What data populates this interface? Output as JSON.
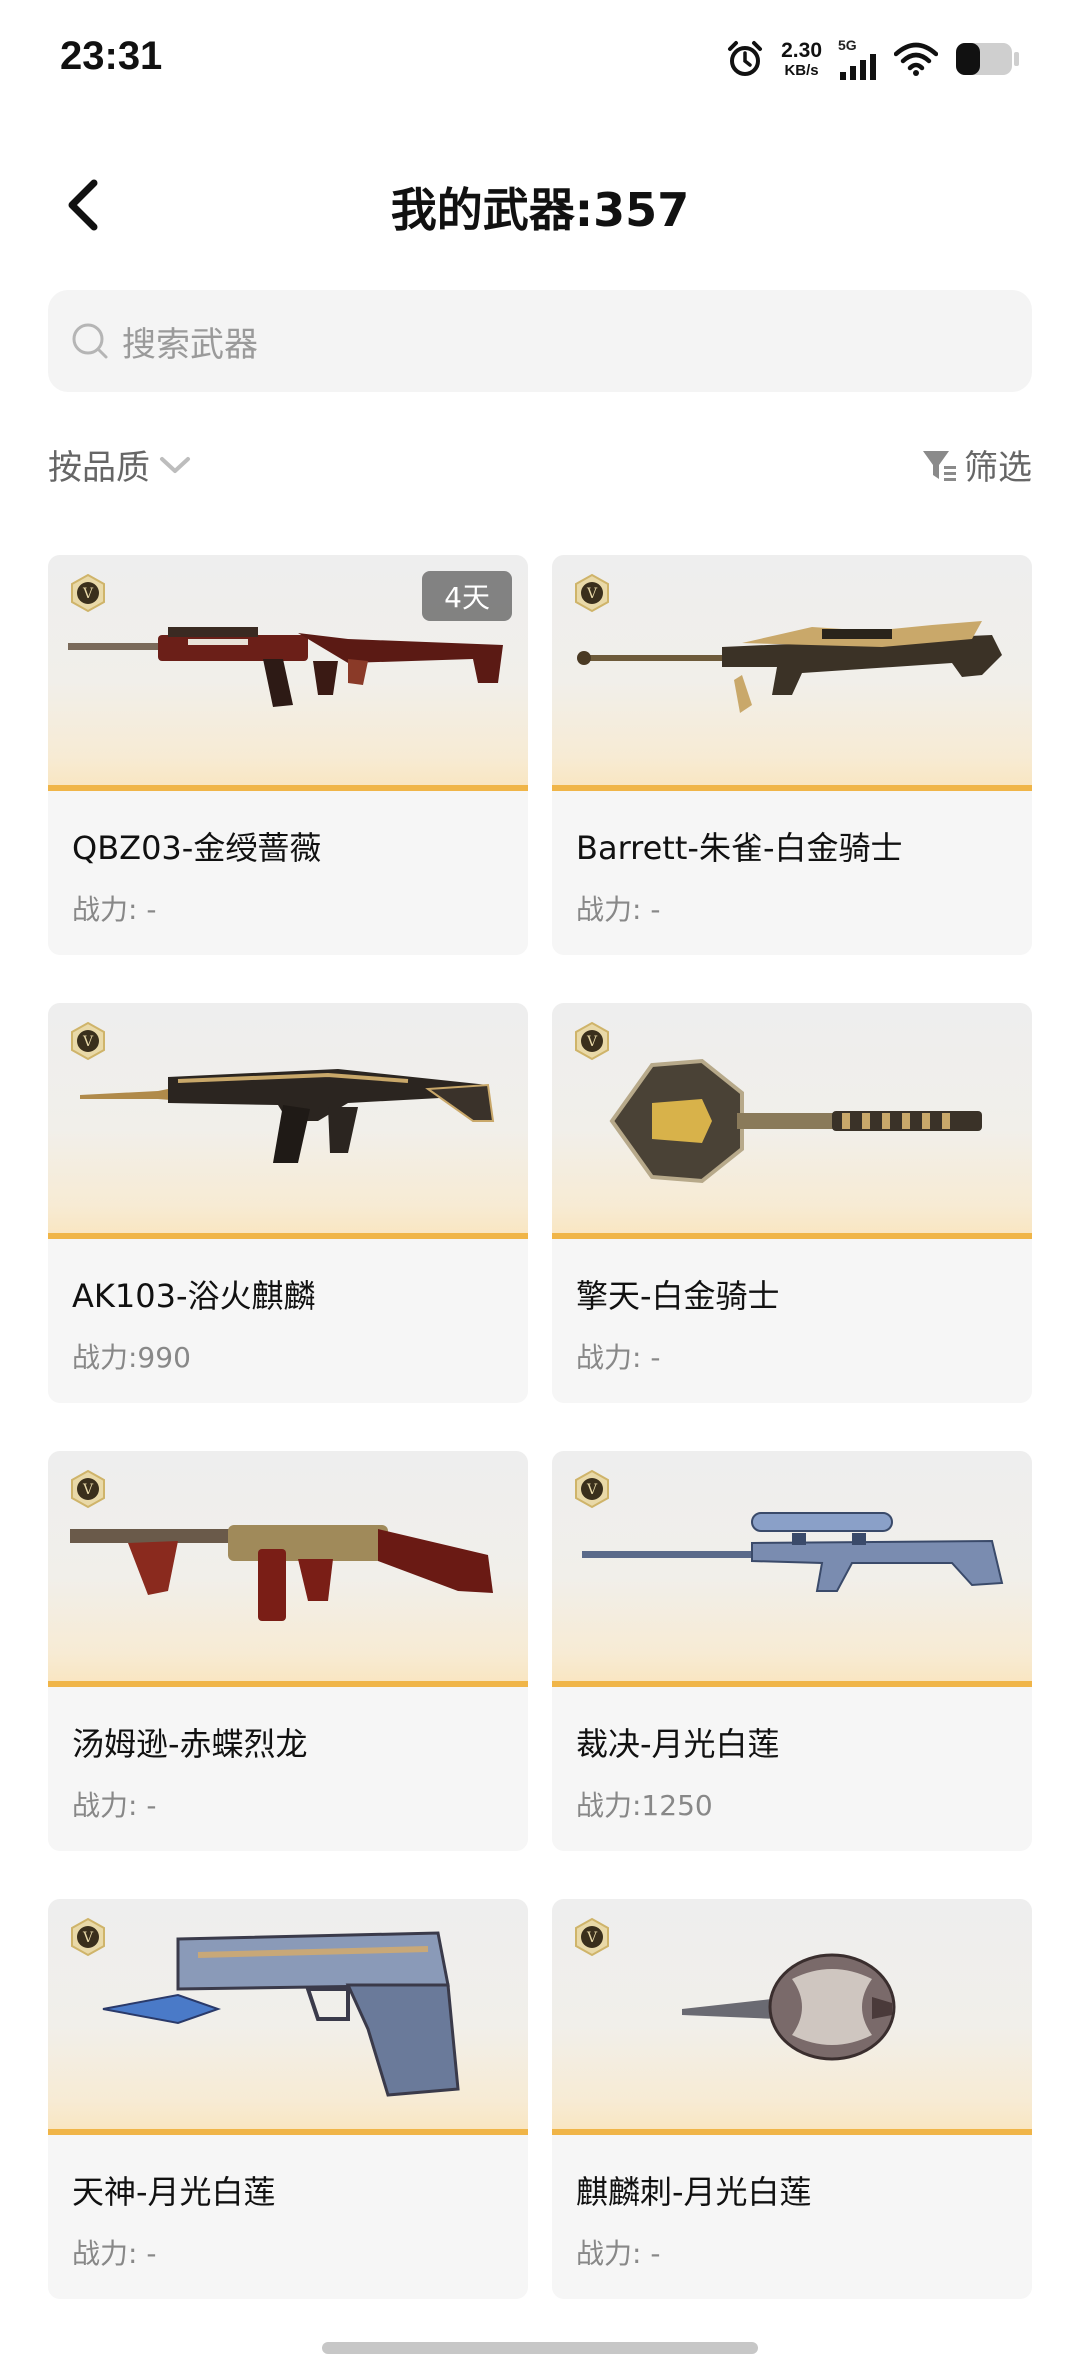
{
  "status_bar": {
    "time": "23:31",
    "net_speed_value": "2.30",
    "net_speed_unit": "KB/s",
    "signal_label": "5G",
    "icons": [
      "alarm-icon",
      "signal-icon",
      "wifi-icon",
      "battery-icon"
    ]
  },
  "header": {
    "title": "我的武器:357",
    "back_icon": "chevron-left-icon"
  },
  "search": {
    "placeholder": "搜索武器"
  },
  "toolbar": {
    "sort_label": "按品质",
    "filter_label": "筛选"
  },
  "weapons": [
    {
      "name": "QBZ03-金绶蔷薇",
      "power": "战力: -",
      "tag": "4天",
      "image_icon": "assault-rifle-icon"
    },
    {
      "name": "Barrett-朱雀-白金骑士",
      "power": "战力: -",
      "image_icon": "sniper-rifle-icon"
    },
    {
      "name": "AK103-浴火麒麟",
      "power": "战力:990",
      "image_icon": "assault-rifle-icon"
    },
    {
      "name": "擎天-白金骑士",
      "power": "战力: -",
      "image_icon": "shovel-melee-icon"
    },
    {
      "name": "汤姆逊-赤蝶烈龙",
      "power": "战力: -",
      "image_icon": "submachine-gun-icon"
    },
    {
      "name": "裁决-月光白莲",
      "power": "战力:1250",
      "image_icon": "sniper-rifle-icon"
    },
    {
      "name": "天神-月光白莲",
      "power": "战力: -",
      "image_icon": "pistol-icon"
    },
    {
      "name": "麒麟刺-月光白莲",
      "power": "战力: -",
      "image_icon": "knife-melee-icon"
    }
  ],
  "colors": {
    "accent_gold": "#f0b548",
    "card_bg": "#f6f6f6",
    "search_bg": "#f4f4f4"
  }
}
